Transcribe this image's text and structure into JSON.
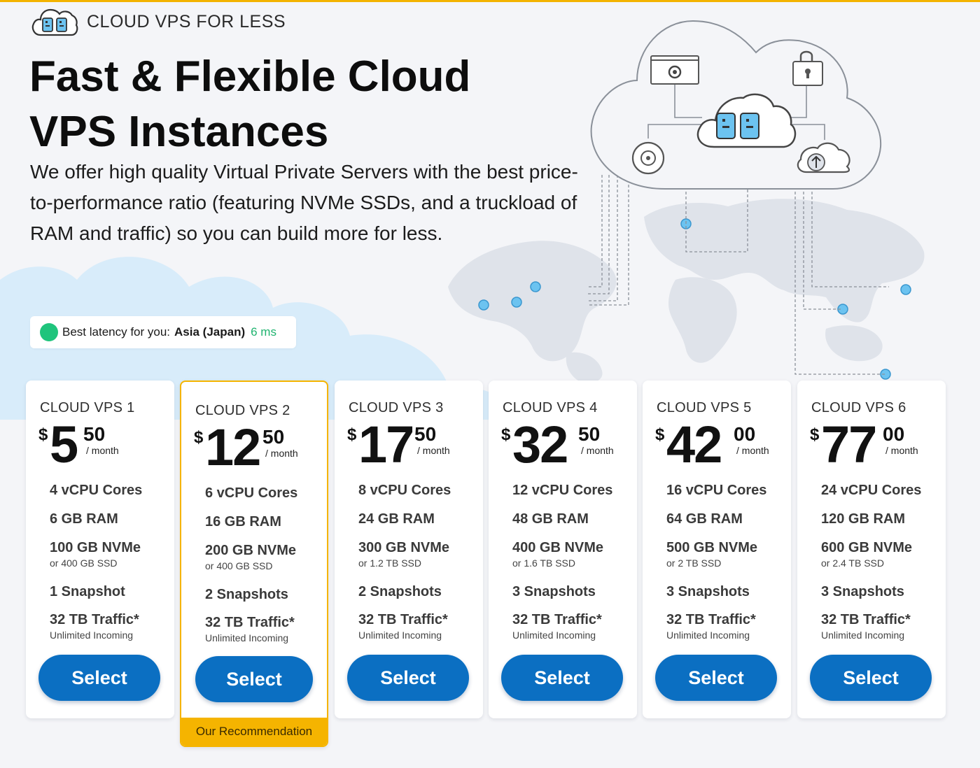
{
  "brand": {
    "name": "CLOUD VPS FOR LESS",
    "logo_icon": "cloud-servers-icon"
  },
  "hero": {
    "title": "Fast & Flexible Cloud VPS Instances",
    "description": "We offer high quality Virtual Private Servers with the best price-to-performance ratio (featuring NVMe SSDs, and a truckload of RAM and traffic) so you can build more for less."
  },
  "latency": {
    "label": "Best latency for you:",
    "location": "Asia (Japan)",
    "value": "6 ms",
    "status_color": "#1fc47c"
  },
  "colors": {
    "accent": "#0b6fc2",
    "recommendation": "#f5b400",
    "latency_ok": "#1fc47c"
  },
  "illustration": {
    "icons": [
      "settings-window-icon",
      "lock-icon",
      "servers-icon",
      "disk-icon",
      "cloud-upload-icon",
      "world-map",
      "location-pin-icon"
    ]
  },
  "plans": [
    {
      "name": "CLOUD VPS 1",
      "currency": "$",
      "price_int": "5",
      "price_cents": "50",
      "period": "/ month",
      "cpu": "4 vCPU Cores",
      "ram": "6 GB RAM",
      "storage": "100 GB NVMe",
      "storage_alt": "or 400 GB SSD",
      "snapshots": "1 Snapshot",
      "traffic": "32 TB Traffic*",
      "incoming": "Unlimited Incoming",
      "button": "Select"
    },
    {
      "name": "CLOUD VPS 2",
      "currency": "$",
      "price_int": "12",
      "price_cents": "50",
      "period": "/ month",
      "cpu": "6 vCPU Cores",
      "ram": "16 GB RAM",
      "storage": "200 GB NVMe",
      "storage_alt": "or 400 GB SSD",
      "snapshots": "2 Snapshots",
      "traffic": "32 TB Traffic*",
      "incoming": "Unlimited Incoming",
      "button": "Select",
      "badge": "Our Recommendation"
    },
    {
      "name": "CLOUD VPS 3",
      "currency": "$",
      "price_int": "17",
      "price_cents": "50",
      "period": "/ month",
      "cpu": "8 vCPU Cores",
      "ram": "24 GB RAM",
      "storage": "300 GB NVMe",
      "storage_alt": "or 1.2 TB SSD",
      "snapshots": "2 Snapshots",
      "traffic": "32 TB Traffic*",
      "incoming": "Unlimited Incoming",
      "button": "Select"
    },
    {
      "name": "CLOUD VPS 4",
      "currency": "$",
      "price_int": "32",
      "price_cents": "50",
      "period": "/ month",
      "cpu": "12 vCPU Cores",
      "ram": "48 GB RAM",
      "storage": "400 GB NVMe",
      "storage_alt": "or 1.6 TB SSD",
      "snapshots": "3 Snapshots",
      "traffic": "32 TB Traffic*",
      "incoming": "Unlimited Incoming",
      "button": "Select"
    },
    {
      "name": "CLOUD VPS 5",
      "currency": "$",
      "price_int": "42",
      "price_cents": "00",
      "period": "/ month",
      "cpu": "16 vCPU Cores",
      "ram": "64 GB RAM",
      "storage": "500 GB NVMe",
      "storage_alt": "or 2 TB SSD",
      "snapshots": "3 Snapshots",
      "traffic": "32 TB Traffic*",
      "incoming": "Unlimited Incoming",
      "button": "Select"
    },
    {
      "name": "CLOUD VPS 6",
      "currency": "$",
      "price_int": "77",
      "price_cents": "00",
      "period": "/ month",
      "cpu": "24 vCPU Cores",
      "ram": "120 GB RAM",
      "storage": "600 GB NVMe",
      "storage_alt": "or 2.4 TB SSD",
      "snapshots": "3 Snapshots",
      "traffic": "32 TB Traffic*",
      "incoming": "Unlimited Incoming",
      "button": "Select"
    }
  ]
}
